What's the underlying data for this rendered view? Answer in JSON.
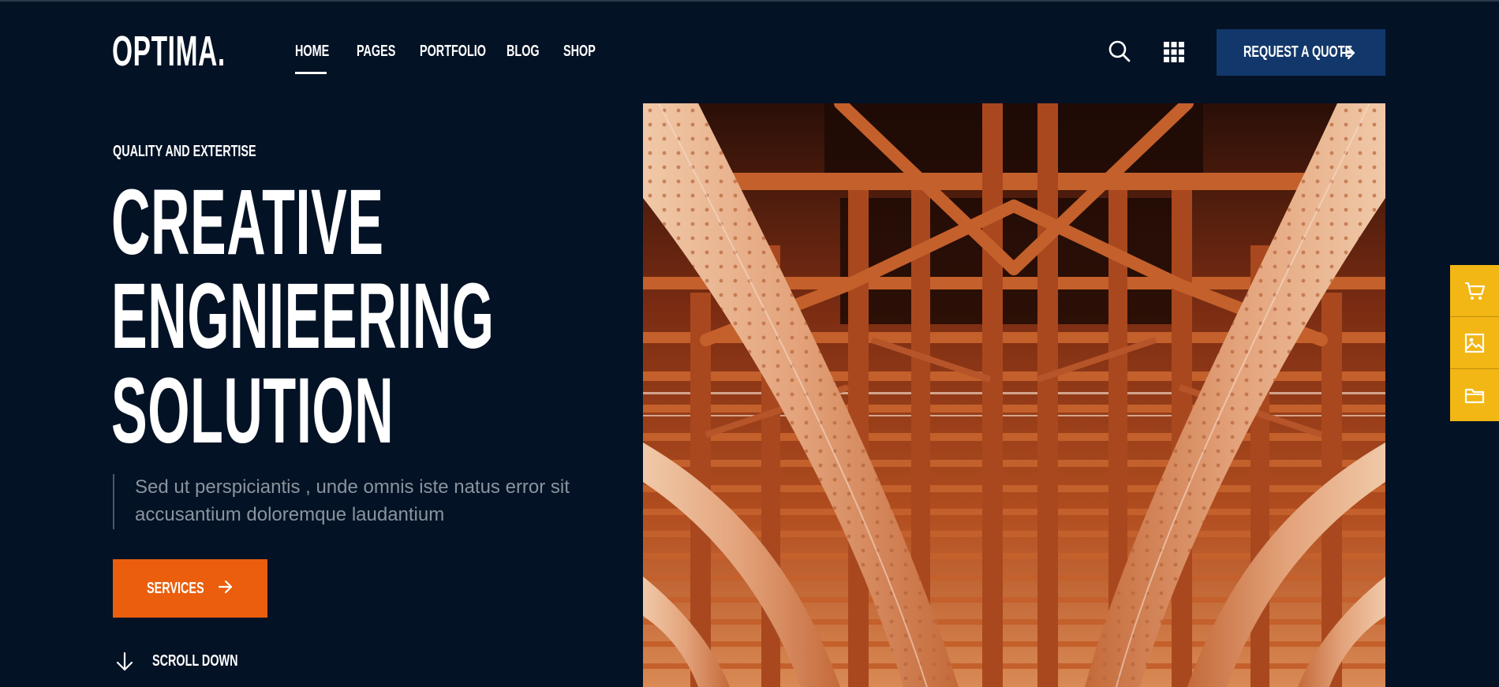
{
  "brand": {
    "logo": "OPTIMA."
  },
  "nav": {
    "items": [
      {
        "label": "HOME",
        "active": true
      },
      {
        "label": "PAGES",
        "active": false
      },
      {
        "label": "PORTFOLIO",
        "active": false
      },
      {
        "label": "BLOG",
        "active": false
      },
      {
        "label": "SHOP",
        "active": false
      }
    ]
  },
  "header": {
    "search_icon": "search-icon",
    "grid_icon": "grid-menu-icon",
    "cta_label": "REQUEST A QUOTE",
    "cta_icon": "arrow-right-icon"
  },
  "hero": {
    "eyebrow": "QUALITY AND EXTERTISE",
    "headline": [
      "CREATIVE",
      "ENGNIEERING",
      "SOLUTION"
    ],
    "lead_line1": "Sed ut perspiciantis , unde omnis iste natus error sit",
    "lead_line2": "accusantium doloremque laudantium",
    "services_label": "SERVICES",
    "scroll_label": "SCROLL DOWN",
    "image_subject": "steel-bridge-underside-photo"
  },
  "side_dock": {
    "items": [
      {
        "icon": "cart-icon"
      },
      {
        "icon": "image-icon"
      },
      {
        "icon": "folder-icon"
      }
    ]
  },
  "colors": {
    "background": "#031225",
    "cta_blue": "#12386b",
    "services_orange": "#ea5e0d",
    "dock_yellow": "#f2b615",
    "lead_text": "#8a949e"
  }
}
